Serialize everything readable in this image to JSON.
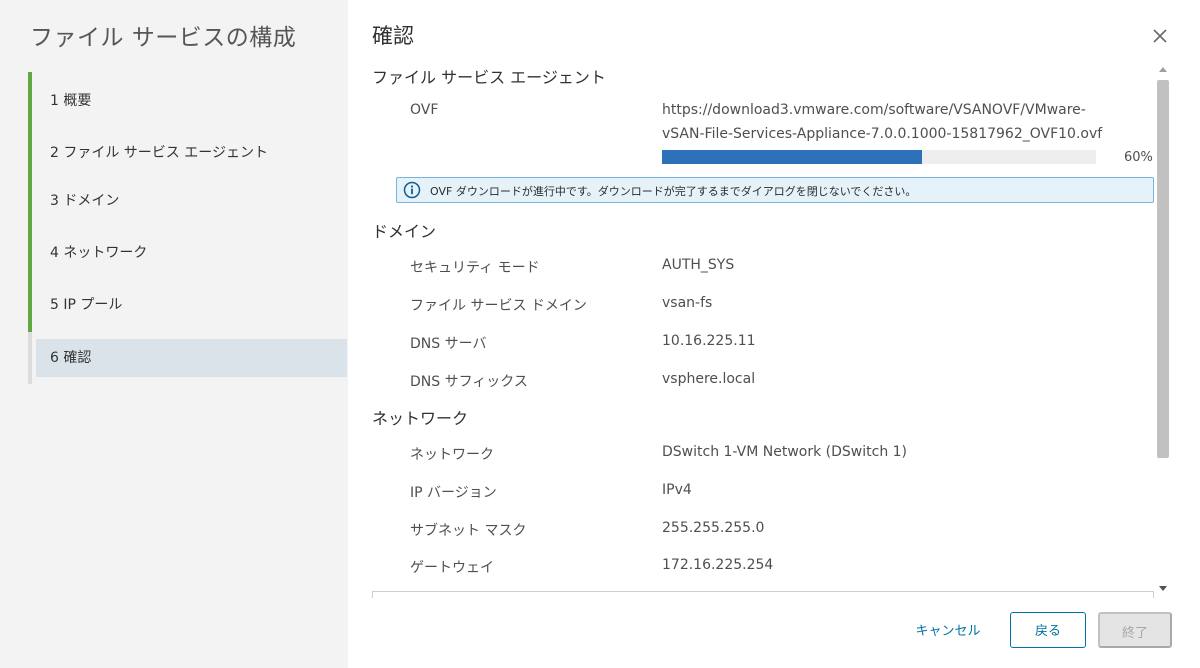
{
  "wizard": {
    "title": "ファイル サービスの構成",
    "steps": [
      {
        "label": "1 概要"
      },
      {
        "label": "2 ファイル サービス エージェント"
      },
      {
        "label": "3 ドメイン"
      },
      {
        "label": "4 ネットワーク"
      },
      {
        "label": "5 IP プール"
      },
      {
        "label": "6 確認"
      }
    ],
    "active_step": 6
  },
  "page": {
    "title": "確認",
    "close_icon": "close-icon"
  },
  "agent_section": {
    "header": "ファイル サービス エージェント",
    "ovf_label": "OVF",
    "ovf_url_line1": "https://download3.vmware.com/software/VSANOVF/VMware-",
    "ovf_url_line2": "vSAN-File-Services-Appliance-7.0.0.1000-15817962_OVF10.ovf",
    "progress_fraction": 0.6,
    "progress_text": "60%",
    "progress_color": "#2d72b8",
    "info_icon": "info-icon",
    "info_message": "OVF ダウンロードが進行中です。ダウンロードが完了するまでダイアログを閉じないでください。"
  },
  "domain_section": {
    "header": "ドメイン",
    "rows": [
      {
        "label": "セキュリティ モード",
        "value": "AUTH_SYS"
      },
      {
        "label": "ファイル サービス ドメイン",
        "value": "vsan-fs"
      },
      {
        "label": "DNS サーバ",
        "value": "10.16.225.11"
      },
      {
        "label": "DNS サフィックス",
        "value": "vsphere.local"
      }
    ]
  },
  "network_section": {
    "header": "ネットワーク",
    "rows": [
      {
        "label": "ネットワーク",
        "value": "DSwitch 1-VM Network (DSwitch 1)"
      },
      {
        "label": "IP バージョン",
        "value": "IPv4"
      },
      {
        "label": "サブネット マスク",
        "value": "255.255.255.0"
      },
      {
        "label": "ゲートウェイ",
        "value": "172.16.225.254"
      }
    ]
  },
  "footer": {
    "cancel_label": "キャンセル",
    "back_label": "戻る",
    "finish_label": "終了"
  },
  "colors": {
    "accent": "#0072a3",
    "step_complete": "#61a744",
    "info_border": "#7ab4da",
    "info_background": "#e6f2fa"
  }
}
